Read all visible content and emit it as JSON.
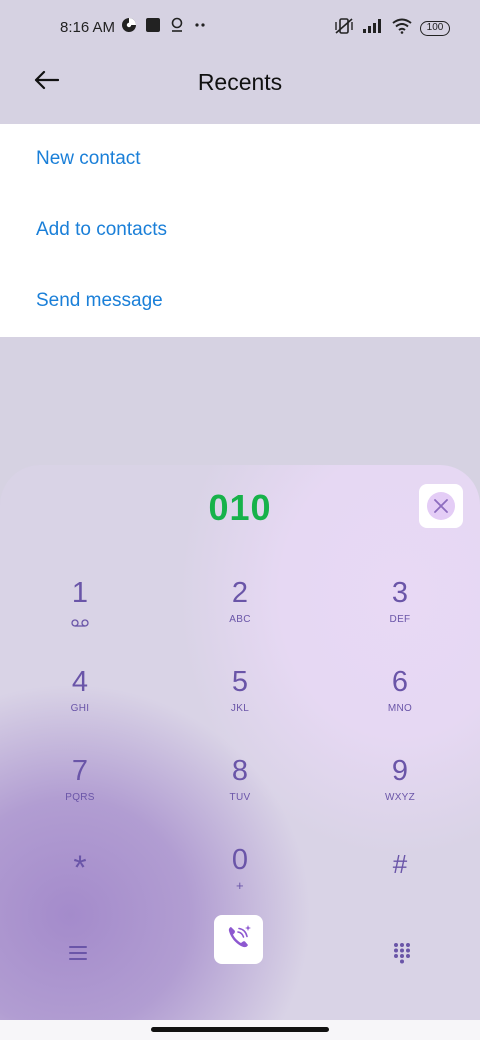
{
  "status_bar": {
    "time": "8:16 AM",
    "battery": "100",
    "icons": [
      "app-notification-icon",
      "square-notification-icon",
      "location-icon",
      "more-dots-icon",
      "vibrate-off-icon",
      "signal-icon",
      "wifi-icon",
      "battery-icon"
    ]
  },
  "app_bar": {
    "title": "Recents",
    "back_icon": "arrow-left-icon"
  },
  "menu": {
    "items": [
      {
        "label": "New contact"
      },
      {
        "label": "Add to contacts"
      },
      {
        "label": "Send message"
      }
    ]
  },
  "dialer": {
    "number": "010",
    "keys": [
      {
        "digit": "1",
        "letters": ""
      },
      {
        "digit": "2",
        "letters": "ABC"
      },
      {
        "digit": "3",
        "letters": "DEF"
      },
      {
        "digit": "4",
        "letters": "GHI"
      },
      {
        "digit": "5",
        "letters": "JKL"
      },
      {
        "digit": "6",
        "letters": "MNO"
      },
      {
        "digit": "7",
        "letters": "PQRS"
      },
      {
        "digit": "8",
        "letters": "TUV"
      },
      {
        "digit": "9",
        "letters": "WXYZ"
      },
      {
        "digit": "*",
        "letters": ""
      },
      {
        "digit": "0",
        "letters": "+"
      },
      {
        "digit": "#",
        "letters": ""
      }
    ]
  },
  "colors": {
    "accent_blue": "#1a7fd8",
    "number_green": "#17b24a",
    "key_purple": "#6a55a8"
  }
}
